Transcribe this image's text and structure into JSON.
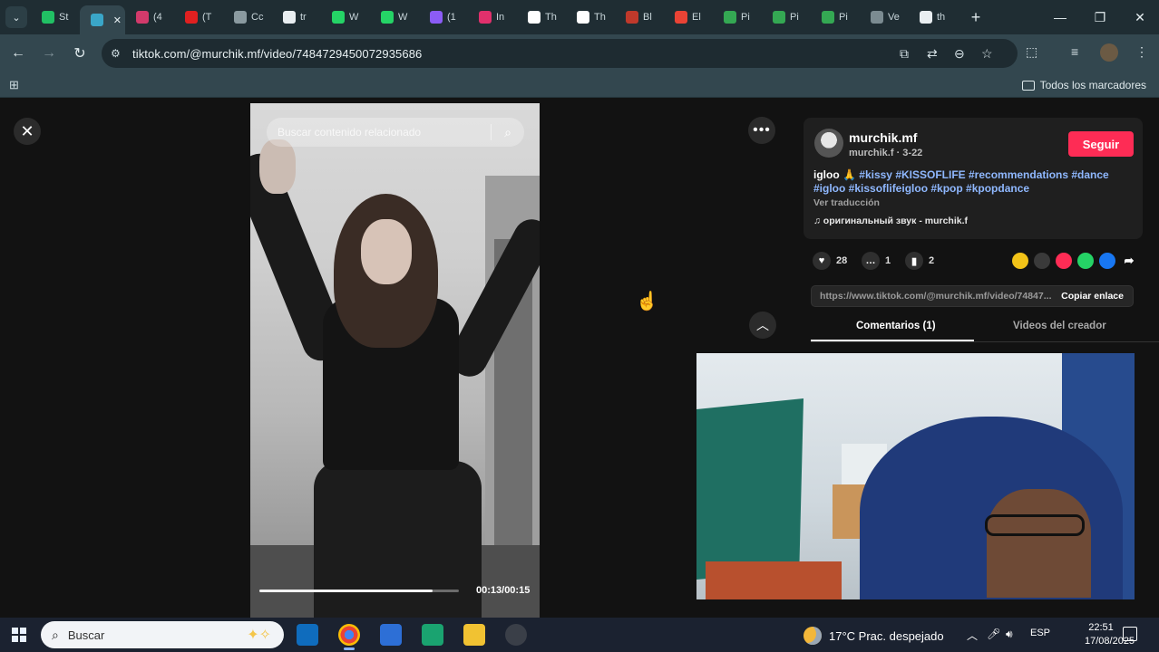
{
  "browser": {
    "tabs": [
      {
        "label": "St",
        "color": "#21c064",
        "active": false
      },
      {
        "label": "",
        "color": "#3aa6c8",
        "active": true
      },
      {
        "label": "(4",
        "color": "#d23a6b",
        "active": false
      },
      {
        "label": "(T",
        "color": "#e02020",
        "active": false
      },
      {
        "label": "Cc",
        "color": "#8a9aa0",
        "active": false
      },
      {
        "label": "tr",
        "color": "#e9eef1",
        "active": false
      },
      {
        "label": "W",
        "color": "#25d366",
        "active": false
      },
      {
        "label": "W",
        "color": "#25d366",
        "active": false
      },
      {
        "label": "(1",
        "color": "#8b5cf6",
        "active": false
      },
      {
        "label": "In",
        "color": "#e1306c",
        "active": false
      },
      {
        "label": "Th",
        "color": "#ffffff",
        "active": false
      },
      {
        "label": "Th",
        "color": "#ffffff",
        "active": false
      },
      {
        "label": "Bl",
        "color": "#c0392b",
        "active": false
      },
      {
        "label": "El",
        "color": "#ea4335",
        "active": false
      },
      {
        "label": "Pi",
        "color": "#34a853",
        "active": false
      },
      {
        "label": "Pi",
        "color": "#34a853",
        "active": false
      },
      {
        "label": "Pi",
        "color": "#34a853",
        "active": false
      },
      {
        "label": "Ve",
        "color": "#7b8b91",
        "active": false
      },
      {
        "label": "th",
        "color": "#e9eef1",
        "active": false
      }
    ],
    "url": "tiktok.com/@murchik.mf/video/7484729450072935686",
    "bookmarks_all": "Todos los marcadores"
  },
  "video": {
    "search_placeholder": "Buscar contenido relacionado",
    "time": "00:13/00:15",
    "progress": 0.87
  },
  "author": {
    "name": "murchik.mf",
    "sub": "murchik.f · 3-22",
    "follow_label": "Seguir"
  },
  "post": {
    "caption_prefix": "igloo 🙏",
    "hashtags_line1": "#kissy #KISSOFLIFE #recommendations #dance",
    "hashtags_line2": "#igloo #kissoflifeigloo #kpop #kpopdance",
    "translate": "Ver traducción",
    "music": "♫ оригинальный звук - murchik.f"
  },
  "actions": {
    "likes": "28",
    "comments": "1",
    "saves": "2"
  },
  "share_icons": [
    {
      "name": "share-coin-icon",
      "color": "#f2c318"
    },
    {
      "name": "share-embed-icon",
      "color": "#3a3a3a"
    },
    {
      "name": "share-send-icon",
      "color": "#fe2c55"
    },
    {
      "name": "share-whatsapp-icon",
      "color": "#25d366"
    },
    {
      "name": "share-facebook-icon",
      "color": "#1877f2"
    }
  ],
  "link": {
    "url": "https://www.tiktok.com/@murchik.mf/video/74847...",
    "copy_label": "Copiar enlace"
  },
  "content_tabs": {
    "comments": "Comentarios (1)",
    "creator_videos": "Videos del creador"
  },
  "taskbar": {
    "search_label": "Buscar",
    "weather": "17°C  Prac. despejado",
    "lang": "ESP",
    "time": "22:51",
    "date": "17/08/2025"
  }
}
